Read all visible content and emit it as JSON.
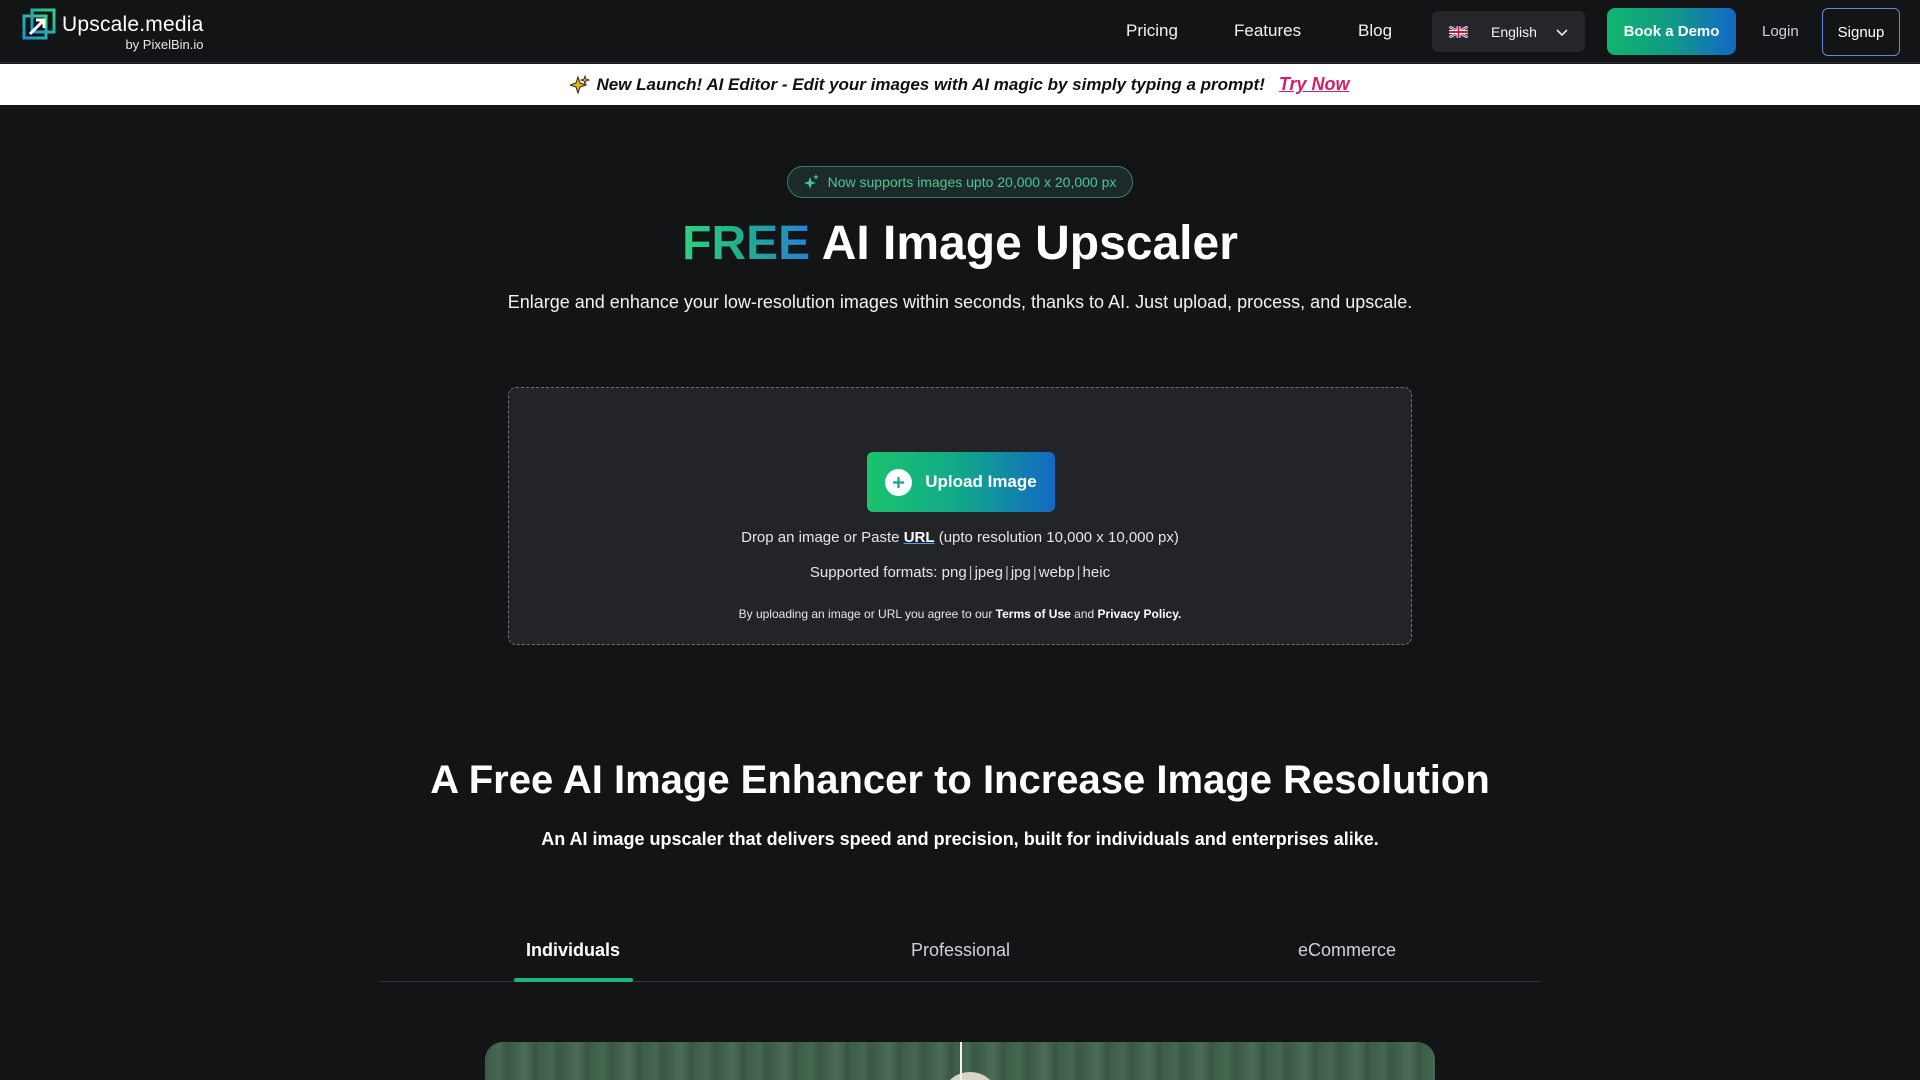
{
  "brand": {
    "name": "Upscale.media",
    "by": "by PixelBin.io"
  },
  "nav": {
    "links": [
      "Pricing",
      "Features",
      "Blog"
    ],
    "language": "English",
    "book_demo": "Book a Demo",
    "login": "Login",
    "signup": "Signup"
  },
  "announcement": {
    "text": "New Launch! AI Editor - Edit your images with AI magic by simply typing a prompt!",
    "cta": "Try Now"
  },
  "hero": {
    "badge": "Now supports images upto 20,000 x 20,000 px",
    "title_highlight": "FREE",
    "title_rest": " AI Image Upscaler",
    "subtitle": "Enlarge and enhance your low-resolution images within seconds, thanks to AI. Just upload, process, and upscale."
  },
  "upload": {
    "button": "Upload Image",
    "drop_prefix": "Drop an image or Paste ",
    "drop_link": "URL",
    "drop_suffix": " (upto resolution 10,000 x 10,000 px)",
    "formats_label": "Supported formats: ",
    "formats": [
      "png",
      "jpeg",
      "jpg",
      "webp",
      "heic"
    ],
    "terms_prefix": "By uploading an image or URL you agree to our ",
    "terms_link": "Terms of Use",
    "terms_and": " and ",
    "privacy_link": "Privacy Policy."
  },
  "section": {
    "title": "A Free AI Image Enhancer to Increase Image Resolution",
    "subtitle": "An AI image upscaler that delivers speed and precision, built for individuals and enterprises alike.",
    "tabs": [
      "Individuals",
      "Professional",
      "eCommerce"
    ],
    "active_tab": "Individuals"
  },
  "colors": {
    "background": "#131416",
    "accent_green": "#1fb37c",
    "accent_blue": "#1469c4",
    "try_now": "#d21f6b"
  }
}
